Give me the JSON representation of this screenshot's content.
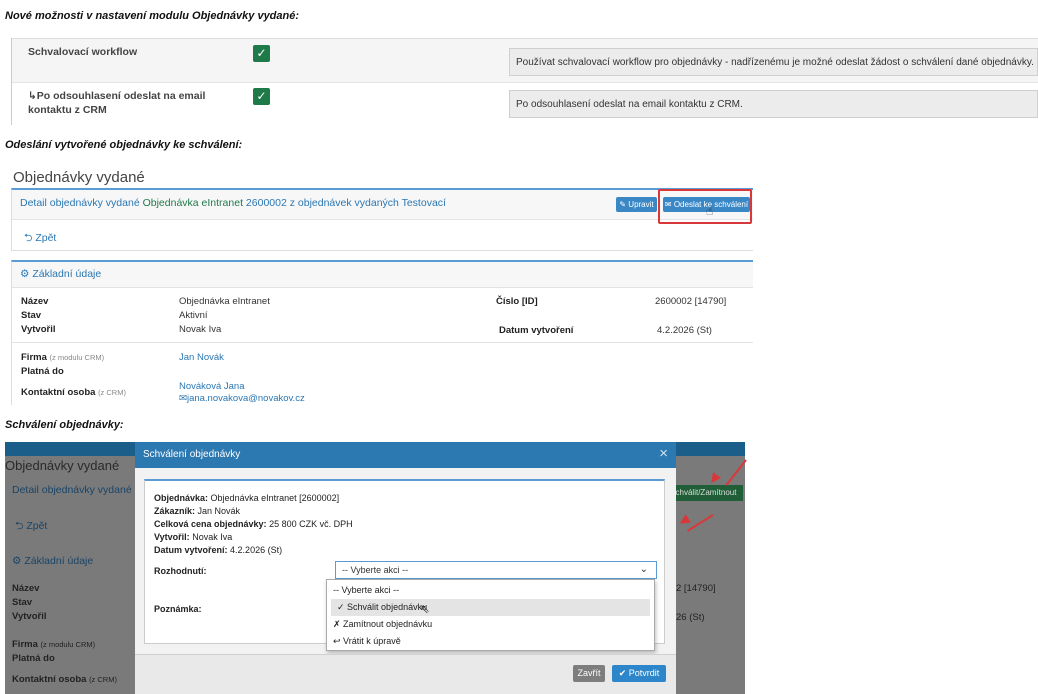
{
  "section1": {
    "heading": "Nové možnosti v nastavení modulu Objednávky vydané:",
    "rows": [
      {
        "label_line1": "Schvalovací workflow",
        "label_line2": "",
        "checked": "✓",
        "description": "Používat schvalovací workflow pro objednávky - nadřízenému je možné odeslat žádost o schválení dané objednávky."
      },
      {
        "label_line1": "↳Po odsouhlasení odeslat na email",
        "label_line2": "kontaktu z CRM",
        "checked": "✓",
        "description": "Po odsouhlasení odeslat na email kontaktu z CRM."
      }
    ]
  },
  "section2": {
    "heading": "Odeslání vytvořené objednávky ke schválení:",
    "panel_title": "Objednávky vydané",
    "detail_prefix": "Detail objednávky vydané",
    "detail_order": "Objednávka eIntranet",
    "detail_suffix": "2600002 z objednávek vydaných Testovací",
    "edit_button": "✎ Upravit",
    "send_button": "✉ Odeslat ke schválení",
    "back_link": "⮌ Zpět",
    "basic_header": "Základní údaje",
    "fields": {
      "name_label": "Název",
      "name_value": "Objednávka eIntranet",
      "state_label": "Stav",
      "state_value": "Aktivní",
      "created_label": "Vytvořil",
      "created_value": "Novak Iva",
      "number_label": "Číslo [ID]",
      "number_value": "2600002 [14790]",
      "date_label": "Datum vytvoření",
      "date_value": "4.2.2026 (St)",
      "firm_label": "Firma",
      "firm_note": "(z modulu CRM)",
      "firm_value": "Jan Novák",
      "valid_label": "Platná do",
      "contact_label": "Kontaktní osoba",
      "contact_note": "(z CRM)",
      "contact_value": "Nováková Jana",
      "contact_email": "✉jana.novakova@novakov.cz"
    }
  },
  "section3": {
    "heading": "Schválení objednávky:",
    "bg": {
      "panel_title": "Objednávky vydané",
      "detail_prefix": "Detail objednávky vydané",
      "back_link": "⮌ Zpět",
      "basic_header": "Základní údaje",
      "name_label": "Název",
      "state_label": "Stav",
      "created_label": "Vytvořil",
      "firm_label": "Firma",
      "firm_note": "(z modulu CRM)",
      "valid_label": "Platná do",
      "contact_label": "Kontaktní osoba",
      "contact_note": "(z CRM)",
      "green_button": "chválit/Zamítnout",
      "number_partial": "2 [14790]",
      "date_partial": "26 (St)"
    },
    "modal": {
      "title": "Schválení objednávky",
      "close": "×",
      "order_label": "Objednávka:",
      "order_value": "Objednávka eIntranet [2600002]",
      "customer_label": "Zákazník:",
      "customer_value": "Jan Novák",
      "price_label": "Celková cena objednávky:",
      "price_value": "25 800 CZK vč. DPH",
      "creator_label": "Vytvořil:",
      "creator_value": "Novak Iva",
      "date_label": "Datum vytvoření:",
      "date_value": "4.2.2026 (St)",
      "decision_label": "Rozhodnutí:",
      "select_value": "-- Vyberte akci --",
      "note_label": "Poznámka:",
      "options": [
        "-- Vyberte akci --",
        "✓ Schválit objednávku",
        "✗ Zamítnout objednávku",
        "↩ Vrátit k úpravě"
      ],
      "close_button": "Zavřít",
      "confirm_button": "✔ Potvrdit"
    }
  }
}
